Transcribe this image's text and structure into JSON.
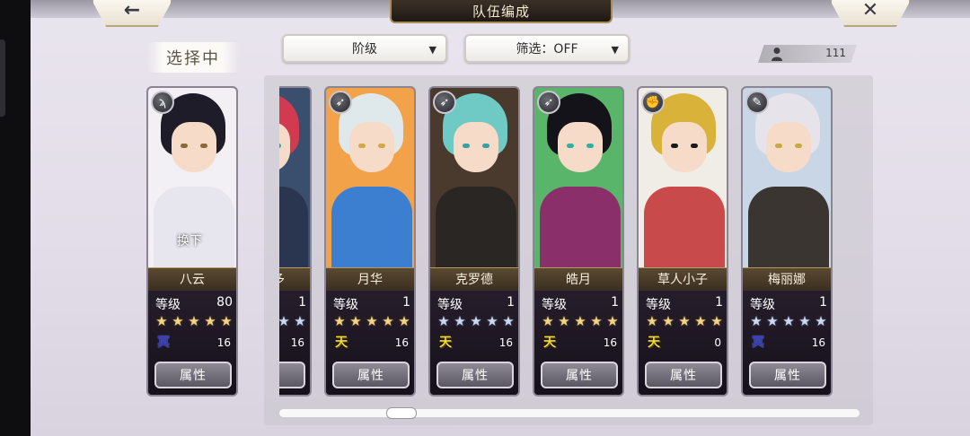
{
  "header": {
    "title": "队伍编成",
    "back_icon": "←",
    "close_icon": "✕"
  },
  "selection": {
    "label": "选择中",
    "swap_text": "换下"
  },
  "filters": {
    "rank_label": "阶级",
    "filter_label": "筛选：OFF",
    "caret": "▼"
  },
  "count": {
    "value": "111"
  },
  "level_label": "等级",
  "attr_label": "属性",
  "star_glyphs": "★★★★★",
  "selected_character": {
    "name": "八云",
    "level": "80",
    "stars": 5,
    "star_color": "gold",
    "rank_icon": "冥",
    "rank_type": "underworld",
    "number": "16",
    "class_icon": "ϡ",
    "colors": {
      "hair": "#1e1c28",
      "body": "#e7e6ee",
      "bg": "#f2f0f4",
      "eye": "#8a6a3a"
    }
  },
  "characters": [
    {
      "name": "维克多",
      "level": "1",
      "stars": 5,
      "star_color": "silver",
      "rank_icon": "",
      "rank_type": "none",
      "number": "16",
      "class_icon": "",
      "colors": {
        "hair": "#d23a52",
        "body": "#2a3550",
        "bg": "#3a4e6e",
        "eye": "#3aa0a0"
      }
    },
    {
      "name": "月华",
      "level": "1",
      "stars": 5,
      "star_color": "gold",
      "rank_icon": "天",
      "rank_type": "heaven",
      "number": "16",
      "class_icon": "➶",
      "colors": {
        "hair": "#dfe8ea",
        "body": "#3c7fd0",
        "bg": "#f2a34a",
        "eye": "#d2a84a"
      }
    },
    {
      "name": "克罗德",
      "level": "1",
      "stars": 5,
      "star_color": "silver",
      "rank_icon": "天",
      "rank_type": "heaven",
      "number": "16",
      "class_icon": "➶",
      "colors": {
        "hair": "#6fc9c4",
        "body": "#2a2624",
        "bg": "#4a3a2e",
        "eye": "#3aa0a0"
      }
    },
    {
      "name": "皓月",
      "level": "1",
      "stars": 5,
      "star_color": "gold",
      "rank_icon": "天",
      "rank_type": "heaven",
      "number": "16",
      "class_icon": "➶",
      "colors": {
        "hair": "#15131a",
        "body": "#8a2f6a",
        "bg": "#59b56a",
        "eye": "#2fb0a0"
      }
    },
    {
      "name": "草人小子",
      "level": "1",
      "stars": 5,
      "star_color": "gold",
      "rank_icon": "天",
      "rank_type": "heaven",
      "number": "0",
      "class_icon": "✊",
      "colors": {
        "hair": "#d9b23a",
        "body": "#c94a4a",
        "bg": "#f0ede6",
        "eye": "#1a1a1a"
      }
    },
    {
      "name": "梅丽娜",
      "level": "1",
      "stars": 5,
      "star_color": "silver",
      "rank_icon": "冥",
      "rank_type": "underworld",
      "number": "16",
      "class_icon": "✎",
      "colors": {
        "hair": "#e6e4ea",
        "body": "#3a3530",
        "bg": "#c9d6e6",
        "eye": "#c9a84a"
      }
    }
  ]
}
